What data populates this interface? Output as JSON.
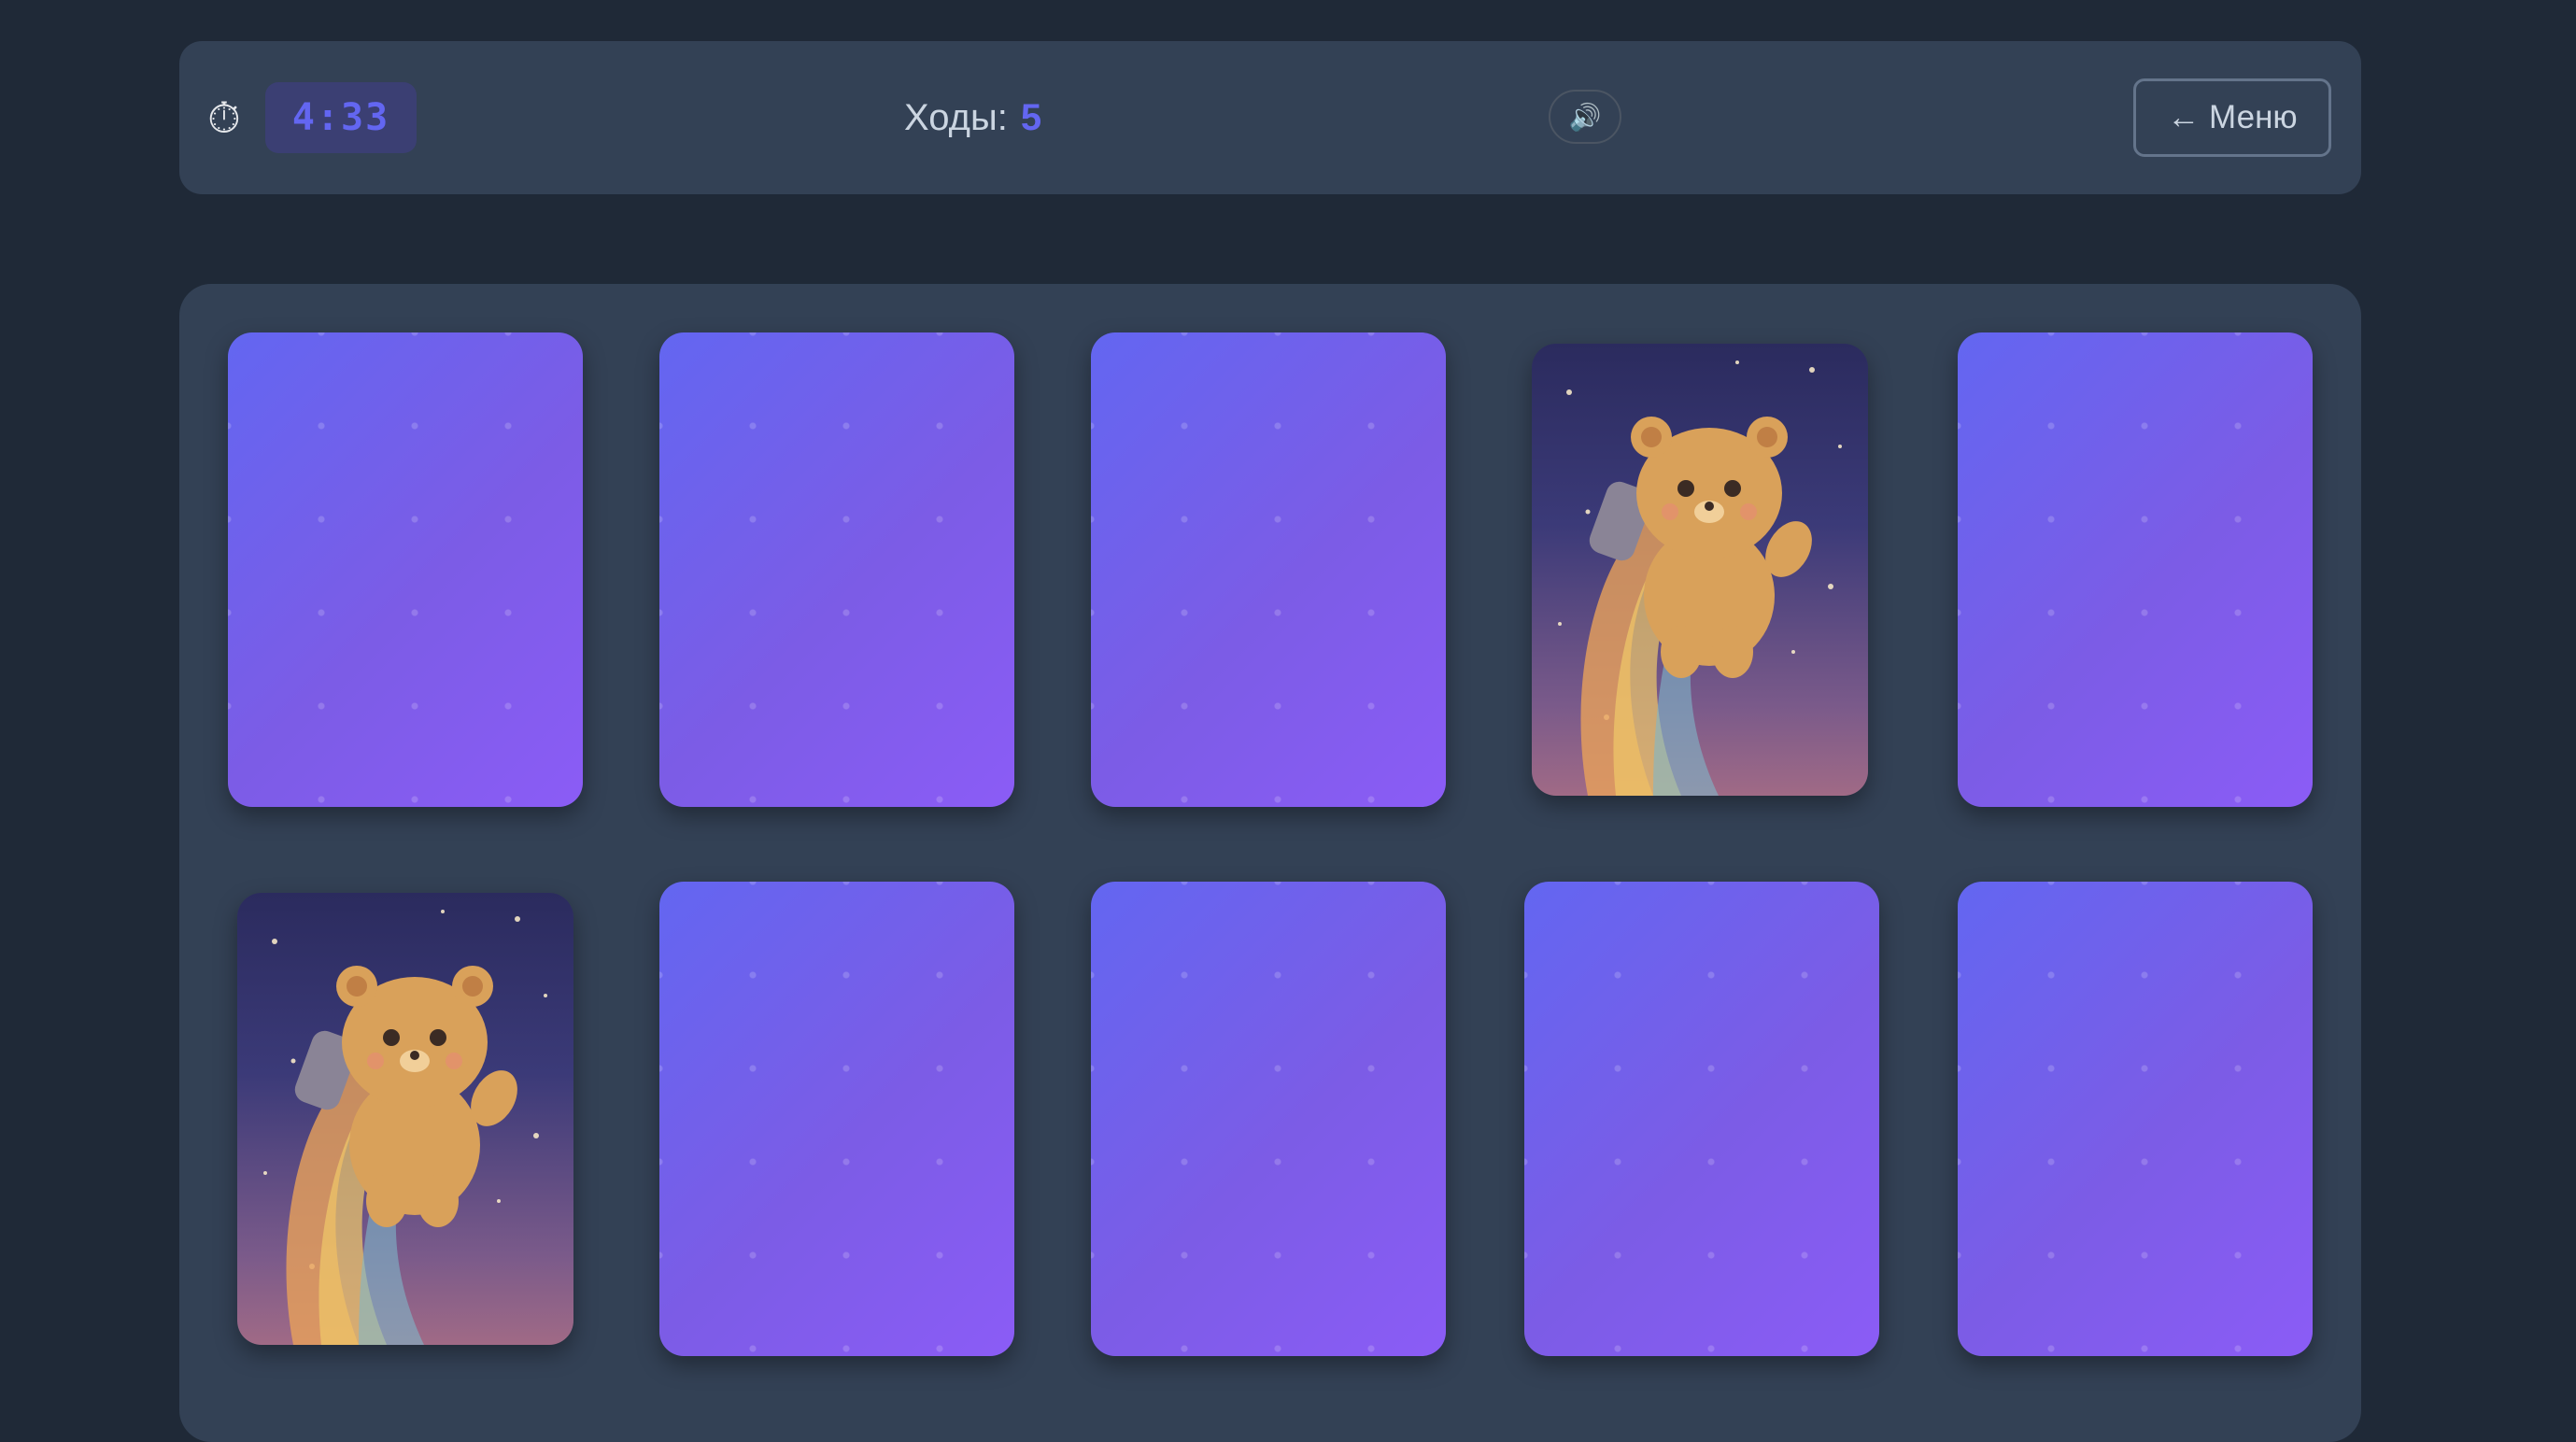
{
  "header": {
    "timer_icon": "⏱",
    "timer_value": "4:33",
    "moves_label": "Ходы:",
    "moves_value": "5",
    "sound_icon": "🔊",
    "menu_label": "← Меню"
  },
  "board": {
    "rows": 2,
    "columns": 5,
    "cards": [
      {
        "state": "face-down"
      },
      {
        "state": "face-down"
      },
      {
        "state": "face-down"
      },
      {
        "state": "face-up",
        "image": "bear-astronaut-icon"
      },
      {
        "state": "face-down"
      },
      {
        "state": "face-up",
        "image": "bear-astronaut-icon"
      },
      {
        "state": "face-down"
      },
      {
        "state": "face-down"
      },
      {
        "state": "face-down"
      },
      {
        "state": "face-down"
      }
    ]
  },
  "colors": {
    "background": "#1f2937",
    "panel": "#334155",
    "accent": "#6366f1",
    "card_back_start": "#6366f1",
    "card_back_end": "#8b5cf6"
  }
}
